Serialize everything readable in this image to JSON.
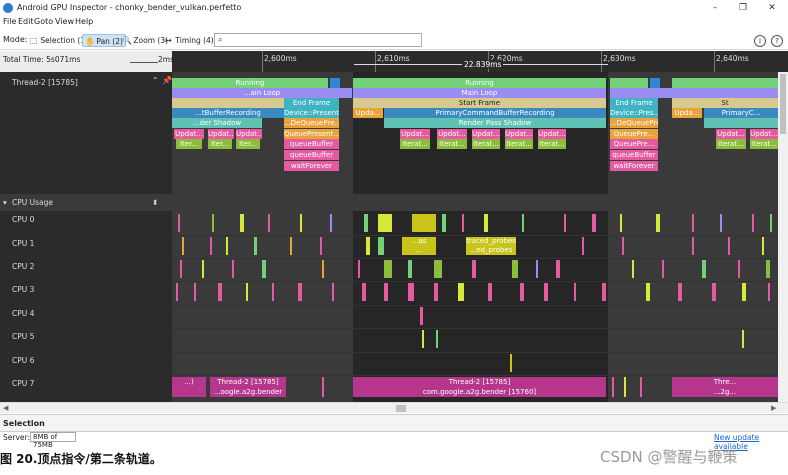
{
  "window": {
    "title": "Android GPU Inspector - chonky_bender_vulkan.perfetto",
    "minimize": "–",
    "maximize": "❐",
    "close": "✕"
  },
  "menu": [
    "File",
    "Edit",
    "Goto",
    "View",
    "Help"
  ],
  "modebar": {
    "label": "Mode:",
    "modes": [
      {
        "label": "Selection (1)",
        "icon": "selection-icon",
        "glyph": "⬚"
      },
      {
        "label": "Pan (2)",
        "icon": "hand-icon",
        "glyph": "✋"
      },
      {
        "label": "Zoom (3)",
        "icon": "zoom-icon",
        "glyph": "🔍"
      },
      {
        "label": "Timing (4)",
        "icon": "timing-icon",
        "glyph": "↦"
      }
    ],
    "active_mode": "Pan (2)",
    "search_placeholder": "",
    "search_icon": "⌕",
    "info_icon": "i",
    "help_icon": "?"
  },
  "timeline": {
    "total_time": "Total Time: 5s071ms",
    "scale_label": "2ms",
    "ticks": [
      "2,600ms",
      "2,610ms",
      "2,620ms",
      "2,630ms",
      "2,640ms"
    ],
    "selection_span": "22.839ms"
  },
  "thread_track": {
    "label": "Thread-2 [15785]",
    "expand_icon": "⌃",
    "pin_icon": "📌"
  },
  "thread_slices": {
    "running": "Running",
    "main_loop": "Main Loop",
    "end_frame": "End Frame",
    "start_frame": "Start Frame",
    "device_present": "Device::Present",
    "device_present_short": "Device::Pres...",
    "buffer_recording": "...tBufferRecording",
    "primary_recording": "PrimaryCommandBufferRecording",
    "primary_short": "PrimaryC...",
    "shadow": "...der Shadow",
    "render_pass_shadow": "Render Pass Shadow",
    "dequeue": "...DeQueuePre...",
    "queue_present": "QueuePresent...",
    "queue_present_short": "QueuePre...",
    "queue_buffer": "queueBuffer",
    "wait_forever": "waitForever",
    "update": "Updat...",
    "update_short": "Upda...",
    "iterate": "Iterat...",
    "iter": "Iter...",
    "main_short": "...ain Loop",
    "st": "St"
  },
  "cpu": {
    "header": "CPU Usage",
    "collapse_icon": "▾",
    "sort_icon": "⬍",
    "rows": [
      "CPU 0",
      "CPU 1",
      "CPU 2",
      "CPU 3",
      "CPU 4",
      "CPU 5",
      "CPU 6",
      "CPU 7"
    ],
    "cpu1_labels": {
      "a": "...as",
      "a2": "...",
      "b": "traced_probes",
      "b2": "...ed_probes"
    },
    "cpu7_labels": {
      "left1": "...)",
      "thread_small": "Thread-2 [15785]",
      "thread_small_sub": "...oogle.a2g.bender",
      "thread_big": "Thread-2 [15785]",
      "thread_big_sub": "com.google.a2g.bender [15760]",
      "right_short": "Thre...",
      "right_sub": "...2g..."
    }
  },
  "panels": {
    "selection_title": "Selection",
    "server_label": "Server:",
    "memory": "8MB of 75MB",
    "update_link": "New update available"
  },
  "caption": "图 20.顶点指令/第二条轨道。",
  "watermark": "CSDN @警醒与鞭策",
  "colors": {
    "running": "#73d17a",
    "main_loop": "#9a8cf0",
    "frame": "#d8c98f",
    "cyan": "#3fb2c4",
    "teal": "#5fc2b4",
    "orange": "#e8a43a",
    "pink": "#e55aa0",
    "green_iter": "#8bbd3a",
    "track_bg": "#262626"
  }
}
